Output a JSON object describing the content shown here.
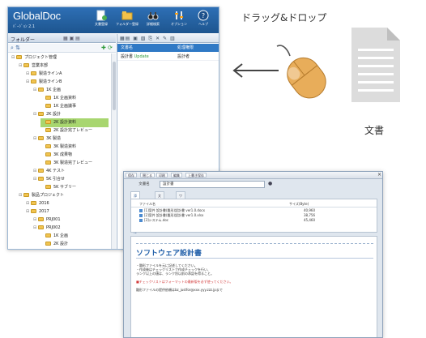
{
  "app": {
    "logo_text": "GlobalDoc",
    "subtitle": "ﾊﾞｰｼﾞｮﾝ 2.1",
    "toolbar": [
      {
        "label": "文書登録",
        "icon": "document-add-icon"
      },
      {
        "label": "フォルダー登録",
        "icon": "folder-add-icon"
      },
      {
        "label": "詳細検索",
        "icon": "binoculars-icon"
      },
      {
        "label": "オプション",
        "icon": "settings-icon"
      },
      {
        "label": "ヘルプ",
        "icon": "help-icon"
      }
    ],
    "folder_pane_label": "フォルダー",
    "tree": [
      {
        "label": "プロジェクト管理",
        "level": 0
      },
      {
        "label": "営業本部",
        "level": 1
      },
      {
        "label": "製造ラインA",
        "level": 2
      },
      {
        "label": "製造ラインB",
        "level": 2
      },
      {
        "label": "1K 企画",
        "level": 3
      },
      {
        "label": "1K 企画資料",
        "level": 4
      },
      {
        "label": "1K 企画議事",
        "level": 4
      },
      {
        "label": "2K 設計",
        "level": 3
      },
      {
        "label": "2K 設計資料",
        "level": 4,
        "selected": true
      },
      {
        "label": "2K 設計完了レビュー",
        "level": 4
      },
      {
        "label": "3K 製造",
        "level": 3
      },
      {
        "label": "3K 製造資料",
        "level": 4
      },
      {
        "label": "3K 成果物",
        "level": 4
      },
      {
        "label": "3K 製造完了レビュー",
        "level": 4
      },
      {
        "label": "4K テスト",
        "level": 3
      },
      {
        "label": "5K 引合せ",
        "level": 3
      },
      {
        "label": "5K サブリー",
        "level": 4
      },
      {
        "label": "製品プロジェクト",
        "level": 1
      },
      {
        "label": "2016",
        "level": 2
      },
      {
        "label": "2017",
        "level": 2
      },
      {
        "label": "PRJ001",
        "level": 3
      },
      {
        "label": "PRJ002",
        "level": 3
      },
      {
        "label": "1K 企画",
        "level": 4
      },
      {
        "label": "2K 設計",
        "level": 4
      }
    ],
    "right_pane": {
      "col_name": "文書名",
      "col_status": "処理権限",
      "row_name": "設計書",
      "row_tag": "Update",
      "row_status": "設計者"
    }
  },
  "drag_drop": {
    "label": "ドラッグ&ドロップ",
    "document_caption": "文書",
    "mouse_color": "#e8ad5a",
    "document_color": "#dcdcdc"
  },
  "viewer": {
    "menu": [
      "保存",
      "閉じる",
      "印刷",
      "編集",
      "上書き保存"
    ],
    "doc_name_label": "文書名",
    "doc_name_value": "設計書",
    "tabs": [
      "添付ファイル",
      "文書情報",
      "ワークフロー"
    ],
    "file_header_name": "ファイル名",
    "file_header_size": "サイズ(Byte)",
    "files": [
      {
        "name": "[1]案件 設計書(雛形)設計書 ver1.0.docx",
        "size": "40,960"
      },
      {
        "name": "[2]案件 設計書(雛形)設計書 ver1.0.xlsx",
        "size": "38,756"
      },
      {
        "name": "[3]システム.doc",
        "size": "45,460"
      }
    ],
    "preview_title": "ソフトウェア設計書",
    "preview_lines": [
      "・雛形ファイルを元に記述してください。",
      "・作成後はチェックリストで作成チェックを行い、",
      "  ランク以上の値は、ランク別以前の承認を得ること。",
      "■チェックリストはフォーマットの最新版を必ず使ってください。",
      "雛形ファイルの提供依頼はbz_justfor@xxx.yyy.zzz.jpまで"
    ]
  }
}
